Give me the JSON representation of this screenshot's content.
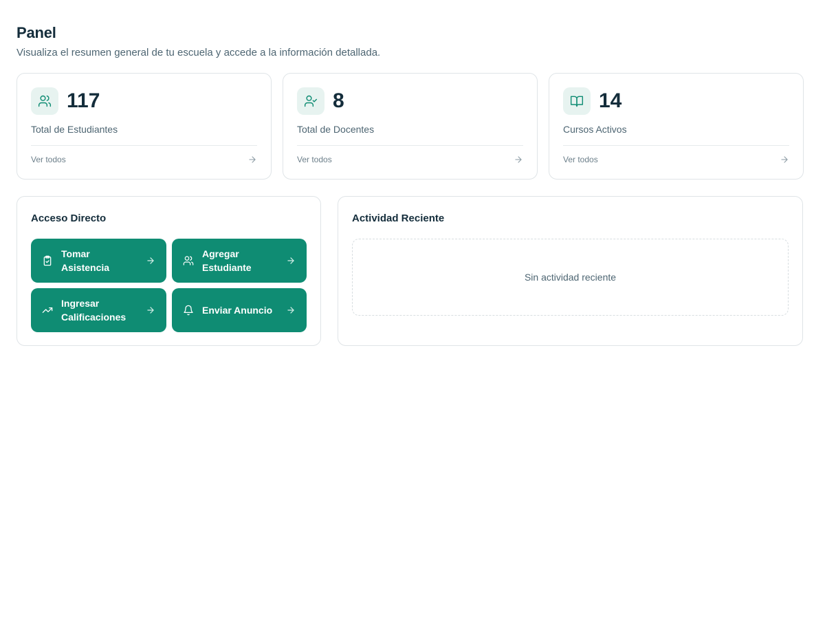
{
  "header": {
    "title": "Panel",
    "subtitle": "Visualiza el resumen general de tu escuela y accede a la información detallada."
  },
  "stats": [
    {
      "icon": "users-icon",
      "value": "117",
      "label": "Total de Estudiantes",
      "link": "Ver todos"
    },
    {
      "icon": "user-check-icon",
      "value": "8",
      "label": "Total de Docentes",
      "link": "Ver todos"
    },
    {
      "icon": "book-open-icon",
      "value": "14",
      "label": "Cursos Activos",
      "link": "Ver todos"
    }
  ],
  "quick_access": {
    "title": "Acceso Directo",
    "items": [
      {
        "icon": "clipboard-check-icon",
        "label": "Tomar Asistencia"
      },
      {
        "icon": "users-icon",
        "label": "Agregar Estudiante"
      },
      {
        "icon": "trending-up-icon",
        "label": "Ingresar Calificaciones"
      },
      {
        "icon": "bell-icon",
        "label": "Enviar Anuncio"
      }
    ]
  },
  "activity": {
    "title": "Actividad Reciente",
    "empty_text": "Sin actividad reciente"
  },
  "colors": {
    "accent": "#0f8c73",
    "icon_bg": "#e7f3f0",
    "text_dark": "#142d3b",
    "text_muted": "#4d6572"
  }
}
